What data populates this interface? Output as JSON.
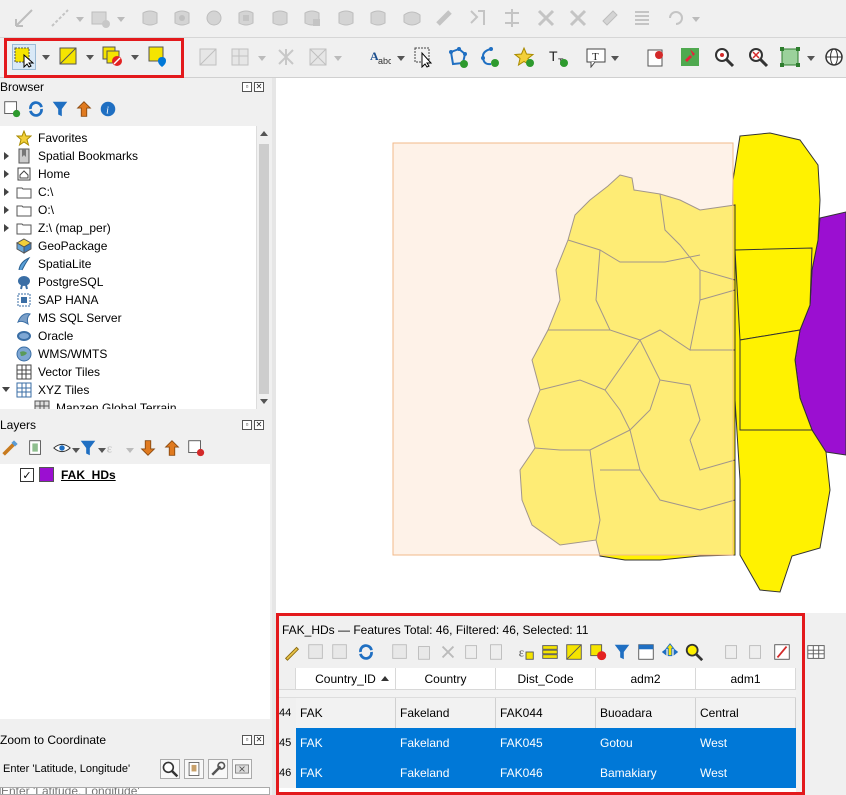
{
  "colors": {
    "highlight": "#e3191c",
    "layer_purple": "#9b0fd1",
    "map_yellow": "#fff200",
    "selection_blue": "#0078d7",
    "extent_fill": "#fde8d6"
  },
  "toolbar1": {
    "icons": [
      "toggle-editing-icon",
      "digitize-icon",
      "add-polygon-icon",
      "move-feature-icon",
      "node-tool-icon",
      "delete-part-icon",
      "add-ring-icon",
      "fill-ring-icon",
      "delete-ring-icon",
      "reshape-icon",
      "offset-curve-icon",
      "split-parts-icon",
      "split-features-icon",
      "merge-attributes-icon",
      "merge-features-icon",
      "rotate-point-icon",
      "simplify-icon",
      "rotate-label-icon"
    ]
  },
  "toolbar2": {
    "icons": [
      "select-features-icon",
      "select-by-value-icon",
      "deselect-icon",
      "select-by-location-icon",
      "identify-icon",
      "measure-icon",
      "text-annotation-icon",
      "select-label-icon",
      "pin-labels-icon",
      "show-labels-icon",
      "change-label-icon",
      "add-text-icon",
      "label-options-icon",
      "new-bookmark-icon",
      "pin-icon",
      "zoom-in-icon",
      "zoom-out-icon",
      "zoom-full-icon",
      "globe-icon"
    ]
  },
  "browser": {
    "title": "Browser",
    "items": [
      {
        "label": "Favorites",
        "icon": "star-icon",
        "arrow": "none"
      },
      {
        "label": "Spatial Bookmarks",
        "icon": "bookmark-icon",
        "arrow": "closed"
      },
      {
        "label": "Home",
        "icon": "home-icon",
        "arrow": "closed"
      },
      {
        "label": "C:\\",
        "icon": "folder-icon",
        "arrow": "closed"
      },
      {
        "label": "O:\\",
        "icon": "folder-icon",
        "arrow": "closed"
      },
      {
        "label": "Z:\\ (map_per)",
        "icon": "folder-icon",
        "arrow": "closed"
      },
      {
        "label": "GeoPackage",
        "icon": "geopackage-icon",
        "arrow": "none"
      },
      {
        "label": "SpatiaLite",
        "icon": "spatialite-icon",
        "arrow": "none"
      },
      {
        "label": "PostgreSQL",
        "icon": "postgresql-icon",
        "arrow": "none"
      },
      {
        "label": "SAP HANA",
        "icon": "sap-hana-icon",
        "arrow": "none"
      },
      {
        "label": "MS SQL Server",
        "icon": "mssql-icon",
        "arrow": "none"
      },
      {
        "label": "Oracle",
        "icon": "oracle-icon",
        "arrow": "none"
      },
      {
        "label": "WMS/WMTS",
        "icon": "wms-icon",
        "arrow": "none"
      },
      {
        "label": "Vector Tiles",
        "icon": "vector-tiles-icon",
        "arrow": "none"
      },
      {
        "label": "XYZ Tiles",
        "icon": "xyz-tiles-icon",
        "arrow": "open"
      },
      {
        "label": "Mapzen Global Terrain",
        "icon": "terrain-icon",
        "arrow": "none"
      }
    ]
  },
  "layers": {
    "title": "Layers",
    "items": [
      {
        "label": "FAK_HDs",
        "checked": true
      }
    ]
  },
  "zoom_panel": {
    "title": "Zoom to Coordinate",
    "placeholder": "Enter 'Latitude, Longitude'"
  },
  "attribute_table": {
    "title": "FAK_HDs — Features Total: 46, Filtered: 46, Selected: 11",
    "columns": [
      "Country_ID",
      "Country",
      "Dist_Code",
      "adm2",
      "adm1"
    ],
    "rows": [
      {
        "num": "44",
        "selected": false,
        "cells": [
          "FAK",
          "Fakeland",
          "FAK044",
          "Buoadara",
          "Central"
        ]
      },
      {
        "num": "45",
        "selected": true,
        "cells": [
          "FAK",
          "Fakeland",
          "FAK045",
          "Gotou",
          "West"
        ]
      },
      {
        "num": "46",
        "selected": true,
        "cells": [
          "FAK",
          "Fakeland",
          "FAK046",
          "Bamakiary",
          "West"
        ]
      }
    ]
  }
}
